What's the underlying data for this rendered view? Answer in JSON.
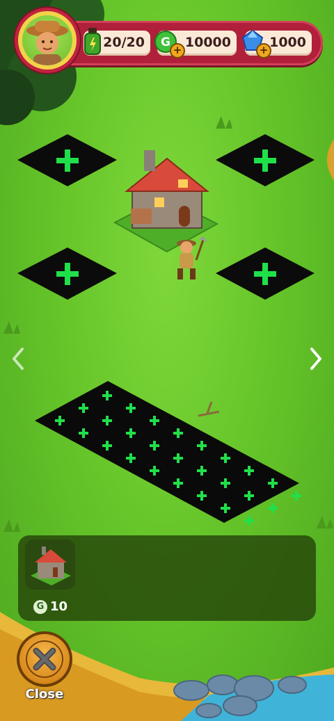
{
  "hud": {
    "energy": "20/20",
    "gold": "10000",
    "gems": "1000"
  },
  "card": {
    "price": "10",
    "coin_symbol": "G"
  },
  "close_label": "Close",
  "nav": {
    "left": "‹",
    "right": "›"
  },
  "icons": {
    "energy": "energy-bottle-icon",
    "gold": "gold-coin-icon",
    "gems": "blue-gem-icon",
    "close": "close-x-icon",
    "plus": "plus-icon"
  },
  "colors": {
    "hud_bar": "#b0203a",
    "plot_plus": "#20e04a",
    "grass": "#66c52a"
  }
}
